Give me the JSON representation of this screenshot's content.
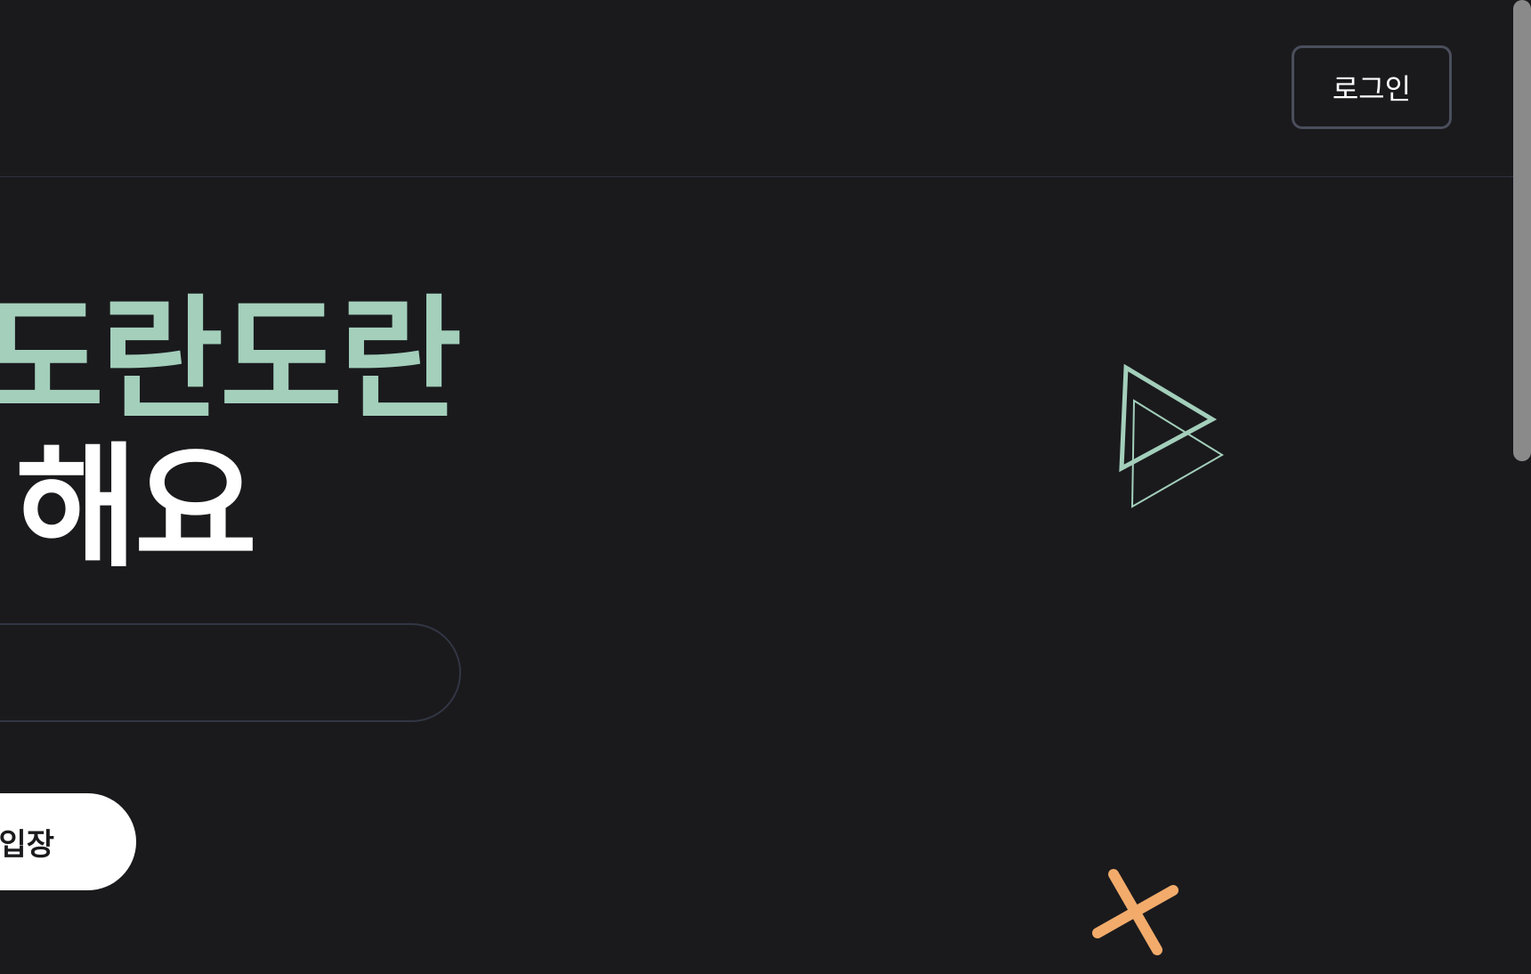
{
  "header": {
    "login_label": "로그인"
  },
  "hero": {
    "headline_line_1": "도란도란",
    "headline_line_2": "해요",
    "input": {
      "value": "",
      "placeholder": ""
    },
    "enter_label": "입장"
  },
  "decorations": {
    "triangles_color": "#a3cfbb",
    "cross_color": "#f2ab6b",
    "triangles_icon": "play-triangles-icon",
    "cross_icon": "cross-icon"
  },
  "colors": {
    "background": "#1a1a1d",
    "accent_mint": "#a3cfbb",
    "accent_orange": "#f2ab6b",
    "divider": "#2e3140"
  }
}
